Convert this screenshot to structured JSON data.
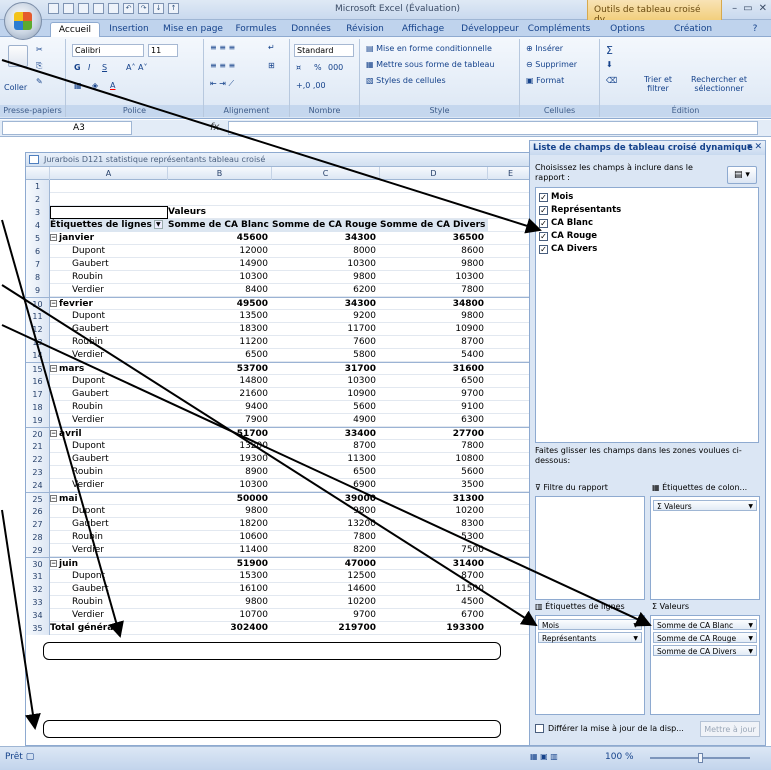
{
  "window": {
    "title": "Microsoft Excel (Évaluation)",
    "context_title": "Outils de tableau croisé dy...",
    "controls": [
      "–",
      "▭",
      "✕"
    ]
  },
  "tabs": [
    "Accueil",
    "Insertion",
    "Mise en page",
    "Formules",
    "Données",
    "Révision",
    "Affichage",
    "Développeur",
    "Compléments",
    "Options",
    "Création"
  ],
  "ribbon": {
    "clipboard": {
      "label": "Presse-papiers",
      "paste": "Coller"
    },
    "font": {
      "label": "Police",
      "name": "Calibri",
      "size": "11",
      "bold": "G",
      "italic": "I",
      "underline": "S"
    },
    "alignment": {
      "label": "Alignement"
    },
    "number": {
      "label": "Nombre",
      "format": "Standard",
      "percent": "%",
      "thousands": "000"
    },
    "style": {
      "label": "Style",
      "conditional": "Mise en forme conditionnelle",
      "as_table": "Mettre sous forme de tableau",
      "cell_styles": "Styles de cellules"
    },
    "cells": {
      "label": "Cellules",
      "insert": "Insérer",
      "delete": "Supprimer",
      "format": "Format"
    },
    "editing": {
      "label": "Édition",
      "sort": "Trier et filtrer",
      "find": "Rechercher et sélectionner",
      "sum": "Σ"
    }
  },
  "formula_bar": {
    "name_box": "A3",
    "fx": "fx",
    "value": ""
  },
  "workbook": {
    "title": "Jurarbois D121 statistique représentants tableau croisé",
    "columns": [
      "A",
      "B",
      "C",
      "D",
      "E"
    ]
  },
  "pivot": {
    "values_label": "Valeurs",
    "row_labels_header": "Étiquettes de lignes",
    "value_headers": [
      "Somme de CA Blanc",
      "Somme de CA Rouge",
      "Somme de CA Divers"
    ],
    "rows": [
      {
        "n": "1",
        "type": "empty"
      },
      {
        "n": "2",
        "type": "empty"
      },
      {
        "n": "3",
        "type": "values"
      },
      {
        "n": "4",
        "type": "header"
      },
      {
        "n": "5",
        "type": "month",
        "label": "janvier",
        "v": [
          "45600",
          "34300",
          "36500"
        ]
      },
      {
        "n": "6",
        "type": "rep",
        "label": "Dupont",
        "v": [
          "12000",
          "8000",
          "8600"
        ]
      },
      {
        "n": "7",
        "type": "rep",
        "label": "Gaubert",
        "v": [
          "14900",
          "10300",
          "9800"
        ]
      },
      {
        "n": "8",
        "type": "rep",
        "label": "Roubin",
        "v": [
          "10300",
          "9800",
          "10300"
        ]
      },
      {
        "n": "9",
        "type": "rep",
        "label": "Verdier",
        "v": [
          "8400",
          "6200",
          "7800"
        ]
      },
      {
        "n": "10",
        "type": "month",
        "label": "fevrier",
        "v": [
          "49500",
          "34300",
          "34800"
        ]
      },
      {
        "n": "11",
        "type": "rep",
        "label": "Dupont",
        "v": [
          "13500",
          "9200",
          "9800"
        ]
      },
      {
        "n": "12",
        "type": "rep",
        "label": "Gaubert",
        "v": [
          "18300",
          "11700",
          "10900"
        ]
      },
      {
        "n": "13",
        "type": "rep",
        "label": "Roubin",
        "v": [
          "11200",
          "7600",
          "8700"
        ]
      },
      {
        "n": "14",
        "type": "rep",
        "label": "Verdier",
        "v": [
          "6500",
          "5800",
          "5400"
        ]
      },
      {
        "n": "15",
        "type": "month",
        "label": "mars",
        "v": [
          "53700",
          "31700",
          "31600"
        ]
      },
      {
        "n": "16",
        "type": "rep",
        "label": "Dupont",
        "v": [
          "14800",
          "10300",
          "6500"
        ]
      },
      {
        "n": "17",
        "type": "rep",
        "label": "Gaubert",
        "v": [
          "21600",
          "10900",
          "9700"
        ]
      },
      {
        "n": "18",
        "type": "rep",
        "label": "Roubin",
        "v": [
          "9400",
          "5600",
          "9100"
        ]
      },
      {
        "n": "19",
        "type": "rep",
        "label": "Verdier",
        "v": [
          "7900",
          "4900",
          "6300"
        ]
      },
      {
        "n": "20",
        "type": "month",
        "label": "avril",
        "v": [
          "51700",
          "33400",
          "27700"
        ]
      },
      {
        "n": "21",
        "type": "rep",
        "label": "Dupont",
        "v": [
          "13200",
          "8700",
          "7800"
        ]
      },
      {
        "n": "22",
        "type": "rep",
        "label": "Gaubert",
        "v": [
          "19300",
          "11300",
          "10800"
        ]
      },
      {
        "n": "23",
        "type": "rep",
        "label": "Roubin",
        "v": [
          "8900",
          "6500",
          "5600"
        ]
      },
      {
        "n": "24",
        "type": "rep",
        "label": "Verdier",
        "v": [
          "10300",
          "6900",
          "3500"
        ]
      },
      {
        "n": "25",
        "type": "month",
        "label": "mai",
        "v": [
          "50000",
          "39000",
          "31300"
        ]
      },
      {
        "n": "26",
        "type": "rep",
        "label": "Dupont",
        "v": [
          "9800",
          "9800",
          "10200"
        ]
      },
      {
        "n": "27",
        "type": "rep",
        "label": "Gaubert",
        "v": [
          "18200",
          "13200",
          "8300"
        ]
      },
      {
        "n": "28",
        "type": "rep",
        "label": "Roubin",
        "v": [
          "10600",
          "7800",
          "5300"
        ]
      },
      {
        "n": "29",
        "type": "rep",
        "label": "Verdier",
        "v": [
          "11400",
          "8200",
          "7500"
        ]
      },
      {
        "n": "30",
        "type": "month",
        "label": "juin",
        "v": [
          "51900",
          "47000",
          "31400"
        ]
      },
      {
        "n": "31",
        "type": "rep",
        "label": "Dupont",
        "v": [
          "15300",
          "12500",
          "8700"
        ]
      },
      {
        "n": "32",
        "type": "rep",
        "label": "Gaubert",
        "v": [
          "16100",
          "14600",
          "11500"
        ]
      },
      {
        "n": "33",
        "type": "rep",
        "label": "Roubin",
        "v": [
          "9800",
          "10200",
          "4500"
        ]
      },
      {
        "n": "34",
        "type": "rep",
        "label": "Verdier",
        "v": [
          "10700",
          "9700",
          "6700"
        ]
      },
      {
        "n": "35",
        "type": "total",
        "label": "Total général",
        "v": [
          "302400",
          "219700",
          "193300"
        ]
      }
    ]
  },
  "field_pane": {
    "title": "Liste de champs de tableau croisé dynamique",
    "instruction": "Choisissez les champs à inclure dans le rapport :",
    "fields": [
      {
        "label": "Mois",
        "checked": true
      },
      {
        "label": "Représentants",
        "checked": true
      },
      {
        "label": "CA Blanc",
        "checked": true
      },
      {
        "label": "CA Rouge",
        "checked": true
      },
      {
        "label": "CA Divers",
        "checked": true
      }
    ],
    "drag_instruction": "Faites glisser les champs dans les zones voulues ci-dessous:",
    "report_filter": "Filtre du rapport",
    "column_labels": "Étiquettes de colon...",
    "row_labels": "Étiquettes de lignes",
    "values": "Valeurs",
    "column_items": [
      "Σ Valeurs"
    ],
    "row_items": [
      "Mois",
      "Représentants"
    ],
    "value_items": [
      "Somme de CA Blanc",
      "Somme de CA Rouge",
      "Somme de CA Divers"
    ],
    "defer": "Différer la mise à jour de la disp...",
    "update": "Mettre à jour"
  },
  "status": {
    "ready": "Prêt",
    "zoom": "100 %"
  }
}
